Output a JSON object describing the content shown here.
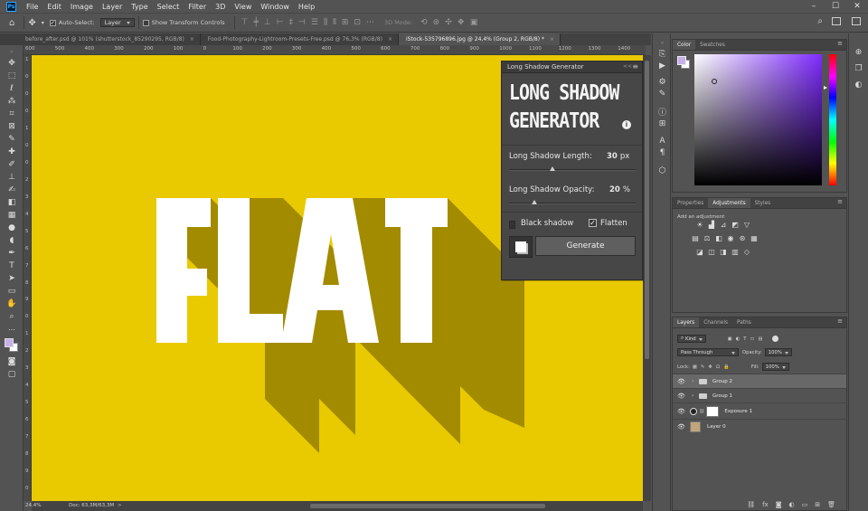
{
  "app": {
    "logo_text": "Ps"
  },
  "menu": [
    "File",
    "Edit",
    "Image",
    "Layer",
    "Type",
    "Select",
    "Filter",
    "3D",
    "View",
    "Window",
    "Help"
  ],
  "window_controls": {
    "minimize": "–",
    "maximize": "☐",
    "close": "✕"
  },
  "options": {
    "auto_select_label": "Auto-Select:",
    "auto_select_value": "Layer",
    "transform_controls_label": "Show Transform Controls",
    "mode_3d_label": "3D Mode:"
  },
  "tabs": [
    {
      "label": "before_after.psd @ 101% (shutterstock_85290295, RGB/8)",
      "close": "×"
    },
    {
      "label": "Food-Photography-Lightroom-Presets-Free.psd @ 76,3% (RGB/8)",
      "close": "×"
    },
    {
      "label": "iStock-535796896.jpg @ 24,4% (Group 2, RGB/8) *",
      "close": "×"
    }
  ],
  "rulers": {
    "top": [
      "600",
      "500",
      "400",
      "300",
      "200",
      "100",
      "0",
      "100",
      "200",
      "300",
      "400",
      "500",
      "600",
      "700",
      "800",
      "900",
      "1000",
      "1100",
      "1200",
      "1300",
      "1400"
    ],
    "left": [
      "1",
      "0",
      "0",
      "0",
      "1",
      "0",
      "0",
      "2",
      "3",
      "4",
      "5",
      "6",
      "7",
      "8",
      "9",
      "0",
      "1",
      "2",
      "3",
      "4",
      "5",
      "6",
      "7",
      "8",
      "9",
      "0"
    ]
  },
  "canvas": {
    "background_color": "#E9C900",
    "shadow_color": "#A38B00",
    "text": "FLAT",
    "text_color": "#FFFFFF"
  },
  "status": {
    "zoom": "24,4%",
    "doc": "Doc: 63,3M/63,3M",
    "arrow": ">"
  },
  "plugin": {
    "panel_title": "Long Shadow Generator",
    "collapse": "<<",
    "heading_line1": "LONG SHADOW",
    "heading_line2": "GENERATOR",
    "info": "i",
    "length_label": "Long Shadow Length:",
    "length_value": "30",
    "length_unit": "px",
    "length_fraction": 0.34,
    "opacity_label": "Long Shadow Opacity:",
    "opacity_value": "20",
    "opacity_unit": "%",
    "opacity_fraction": 0.2,
    "black_shadow_label": "Black shadow",
    "black_shadow_checked": false,
    "flatten_label": "Flatten",
    "flatten_checked": true,
    "generate_label": "Generate"
  },
  "color_panel": {
    "tabs": [
      "Color",
      "Swatches"
    ],
    "foreground": "#C6B0E8",
    "hue": "#7F2BFF"
  },
  "adj_panel": {
    "tabs": [
      "Properties",
      "Adjustments",
      "Styles"
    ],
    "active": 1,
    "hint": "Add an adjustment"
  },
  "layers_panel": {
    "tabs": [
      "Layers",
      "Channels",
      "Paths"
    ],
    "kind_label": "Kind",
    "blend_mode": "Pass Through",
    "opacity_label": "Opacity:",
    "opacity_value": "100%",
    "lock_label": "Lock:",
    "fill_label": "Fill:",
    "fill_value": "100%",
    "layers": [
      {
        "name": "Group 2",
        "type": "group",
        "selected": true
      },
      {
        "name": "Group 1",
        "type": "group",
        "selected": false
      },
      {
        "name": "Exposure 1",
        "type": "adjustment",
        "selected": false
      },
      {
        "name": "Layer 0",
        "type": "image",
        "selected": false
      }
    ],
    "footer_icons": [
      "link-icon",
      "fx-icon",
      "mask-icon",
      "adjustment-icon",
      "folder-icon",
      "new-layer-icon",
      "trash-icon"
    ]
  }
}
